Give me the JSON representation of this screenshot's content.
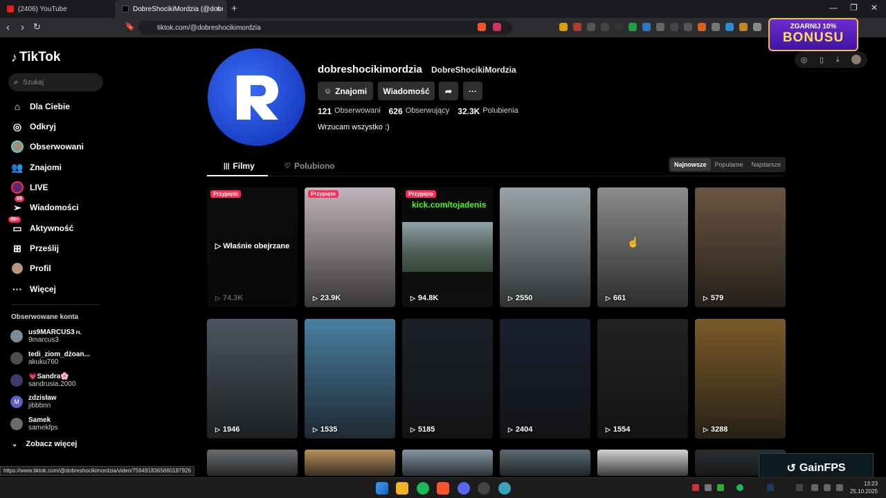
{
  "browser": {
    "tabs": [
      {
        "title": "(2406) YouTube"
      },
      {
        "title": "DobreShocikiMordzia (@dobres"
      }
    ],
    "url": "tiktok.com/@dobreshocikimordzia",
    "status_url": "https://www.tiktok.com/@dobreshocikimordzia/video/7564918365660187926"
  },
  "ad": {
    "line1": "ZGARNIJ 10%",
    "line2": "BONUSU"
  },
  "sidebar": {
    "logo": "TikTok",
    "search_placeholder": "Szukaj",
    "items": [
      {
        "label": "Dla Ciebie",
        "icon": "home-icon"
      },
      {
        "label": "Odkryj",
        "icon": "compass-icon"
      },
      {
        "label": "Obserwowani",
        "icon": "avatar-icon"
      },
      {
        "label": "Znajomi",
        "icon": "friends-icon"
      },
      {
        "label": "LIVE",
        "icon": "live-icon"
      },
      {
        "label": "Wiadomości",
        "icon": "send-icon",
        "badge": "68"
      },
      {
        "label": "Aktywność",
        "icon": "inbox-icon",
        "badge": "99+"
      },
      {
        "label": "Prześlij",
        "icon": "upload-icon"
      },
      {
        "label": "Profil",
        "icon": "profile-icon"
      },
      {
        "label": "Więcej",
        "icon": "more-icon"
      }
    ],
    "followed_title": "Obserwowane konta",
    "accounts": [
      {
        "name": "us9MARCUS3",
        "suffix": "PL",
        "handle": "9marcus3"
      },
      {
        "name": "tedi_ziom_dżoan...",
        "handle": "akuku760"
      },
      {
        "name": "💗Sandra🌸",
        "handle": "sandrusia.2000"
      },
      {
        "name": "zdzisław",
        "handle": "jibbbnn",
        "initial": "M"
      },
      {
        "name": "Samek",
        "handle": "samekfps"
      }
    ],
    "see_more": "Zobacz więcej"
  },
  "profile": {
    "username": "dobreshocikimordzia",
    "nickname": "DobreShocikiMordzia",
    "buttons": {
      "friends": "Znajomi",
      "message": "Wiadomość"
    },
    "stats": {
      "following": "121",
      "following_label": "Obserwowani",
      "followers": "626",
      "followers_label": "Obserwujący",
      "likes": "32.3K",
      "likes_label": "Polubienia"
    },
    "bio": "Wrzucam wszystko :)",
    "tabs": {
      "videos": "Filmy",
      "liked": "Polubiono"
    },
    "sort": [
      "Najnowsze",
      "Popularne",
      "Najstarsze"
    ]
  },
  "videos": [
    {
      "views": "74.3K",
      "pinned": "Przypięto",
      "watched": "Właśnie obejrzane",
      "color": "#1d1d1d"
    },
    {
      "views": "23.9K",
      "pinned": "Przypięto",
      "color": "#c0b5bc"
    },
    {
      "views": "94.8K",
      "pinned": "Przypięto",
      "kick": "kick.com/tojadenis",
      "color": "#0e0e0e"
    },
    {
      "views": "2550",
      "color": "#9aa3a8"
    },
    {
      "views": "661",
      "color": "#8b8d8a"
    },
    {
      "views": "579",
      "color": "#6b5540"
    },
    {
      "views": "1946",
      "color": "#4c5660"
    },
    {
      "views": "1535",
      "color": "#4a7fa2"
    },
    {
      "views": "5185",
      "color": "#1c2128"
    },
    {
      "views": "2404",
      "color": "#1a2030"
    },
    {
      "views": "1554",
      "color": "#232222"
    },
    {
      "views": "3288",
      "color": "#7a5a2a"
    },
    {
      "views": "",
      "color": "#6a6f74"
    },
    {
      "views": "",
      "color": "#b9915b"
    },
    {
      "views": "",
      "color": "#8797a6"
    },
    {
      "views": "",
      "color": "#5a6c72"
    },
    {
      "views": "",
      "color": "#cfd2d3"
    },
    {
      "views": "",
      "color": "#2b2f32"
    }
  ],
  "overlay": {
    "gainfps": "GainFPS"
  },
  "clock": {
    "time": "13:23",
    "date": "25.10.2025"
  },
  "colors": {
    "accent": "#fe2c55",
    "bg": "#000000"
  }
}
